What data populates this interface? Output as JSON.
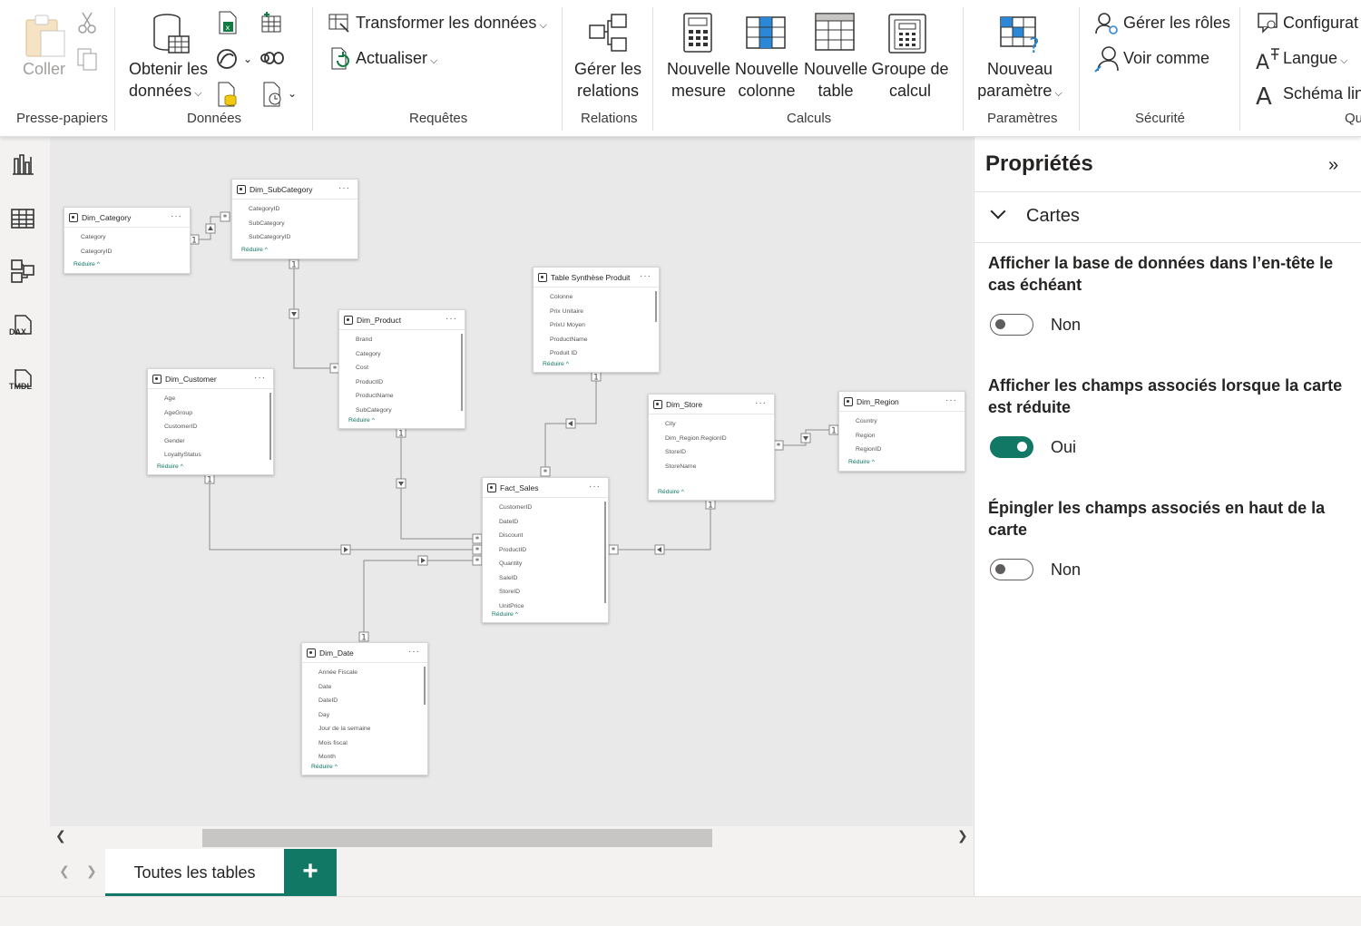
{
  "ribbon": {
    "clipboard": {
      "paste": "Coller",
      "group": "Presse-papiers"
    },
    "data": {
      "get_data_line1": "Obtenir les",
      "get_data_line2": "données",
      "group": "Données"
    },
    "queries": {
      "transform": "Transformer les données",
      "refresh": "Actualiser",
      "group": "Requêtes"
    },
    "relations": {
      "manage_line1": "Gérer les",
      "manage_line2": "relations",
      "group": "Relations"
    },
    "calculs": {
      "new_measure_1": "Nouvelle",
      "new_measure_2": "mesure",
      "new_column_1": "Nouvelle",
      "new_column_2": "colonne",
      "new_table_1": "Nouvelle",
      "new_table_2": "table",
      "calc_group_1": "Groupe de",
      "calc_group_2": "calcul",
      "group": "Calculs"
    },
    "params": {
      "new_param_1": "Nouveau",
      "new_param_2": "paramètre",
      "group": "Paramètres"
    },
    "security": {
      "manage_roles": "Gérer les rôles",
      "view_as": "Voir comme",
      "group": "Sécurité"
    },
    "qa": {
      "config": "Configurat",
      "language": "Langue",
      "schema": "Schéma lin",
      "group": "Qu"
    }
  },
  "rail": {
    "icons": [
      "report-view-icon",
      "table-view-icon",
      "model-view-icon",
      "dax-query-icon",
      "tmdl-icon"
    ],
    "dax": "DAX",
    "tmdl": "TMDL"
  },
  "tables": {
    "dim_category": {
      "title": "Dim_Category",
      "fields": [
        "Category",
        "CategoryID"
      ],
      "footer": "Réduire ^"
    },
    "dim_subcategory": {
      "title": "Dim_SubCategory",
      "fields": [
        "CategoryID",
        "SubCategory",
        "SubCategoryID"
      ],
      "footer": "Réduire ^"
    },
    "dim_product": {
      "title": "Dim_Product",
      "fields": [
        "Brand",
        "Category",
        "Cost",
        "ProductID",
        "ProductName",
        "SubCategory"
      ],
      "footer": "Réduire ^"
    },
    "table_synthese": {
      "title": "Table Synthèse Produit",
      "fields": [
        "Colonne",
        "Prix Unitaire",
        "PrixU Moyen",
        "ProductName",
        "Produit ID"
      ],
      "footer": "Réduire ^"
    },
    "dim_customer": {
      "title": "Dim_Customer",
      "fields": [
        "Age",
        "AgeGroup",
        "CustomerID",
        "Gender",
        "LoyaltyStatus"
      ],
      "footer": "Réduire ^"
    },
    "dim_store": {
      "title": "Dim_Store",
      "fields": [
        "City",
        "Dim_Region.RegionID",
        "StoreID",
        "StoreName"
      ],
      "footer": "Réduire ^"
    },
    "dim_region": {
      "title": "Dim_Region",
      "fields": [
        "Country",
        "Region",
        "RegionID"
      ],
      "footer": "Réduire ^"
    },
    "fact_sales": {
      "title": "Fact_Sales",
      "fields": [
        "CustomerID",
        "DateID",
        "Discount",
        "ProductID",
        "Quantity",
        "SaleID",
        "StoreID",
        "UnitPrice"
      ],
      "footer": "Réduire ^"
    },
    "dim_date": {
      "title": "Dim_Date",
      "fields": [
        "Année Fiscale",
        "Date",
        "DateID",
        "Day",
        "Jour de la semaine",
        "Mois fiscal",
        "Month"
      ],
      "footer": "Réduire ^"
    }
  },
  "card_more": "···",
  "markers": {
    "one": "1",
    "many": "*"
  },
  "tabs": {
    "all_tables": "Toutes les tables",
    "add": "+"
  },
  "properties": {
    "title": "Propriétés",
    "section": "Cartes",
    "options": [
      {
        "label": "Afficher la base de données dans l’en-tête le cas échéant",
        "state": "Non",
        "on": false
      },
      {
        "label": "Afficher les champs associés lorsque la carte est réduite",
        "state": "Oui",
        "on": true
      },
      {
        "label": "Épingler les champs associés en haut de la carte",
        "state": "Non",
        "on": false
      }
    ]
  },
  "colors": {
    "accent": "#117865"
  }
}
